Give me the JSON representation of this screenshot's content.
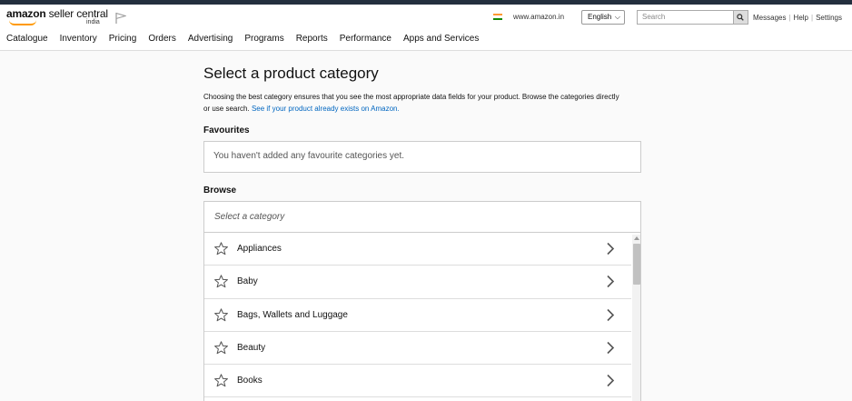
{
  "header": {
    "logo_text_bold": "amazon",
    "logo_text": " seller central",
    "logo_region": "india",
    "marketplace": "www.amazon.in",
    "language": "English",
    "search_placeholder": "Search",
    "links": [
      "Messages",
      "Help",
      "Settings"
    ]
  },
  "nav": [
    "Catalogue",
    "Inventory",
    "Pricing",
    "Orders",
    "Advertising",
    "Programs",
    "Reports",
    "Performance",
    "Apps and Services"
  ],
  "page": {
    "title": "Select a product category",
    "description": "Choosing the best category ensures that you see the most appropriate data fields for your product. Browse the categories directly or use search.",
    "description_link": "See if your product already exists on Amazon.",
    "favourites_label": "Favourites",
    "favourites_empty": "You haven't added any favourite categories yet.",
    "browse_label": "Browse",
    "category_placeholder": "Select a category"
  },
  "categories": [
    "Appliances",
    "Baby",
    "Bags, Wallets and Luggage",
    "Beauty",
    "Books"
  ],
  "colors": {
    "top_strip": "#232f3e",
    "accent": "#ff9900",
    "link": "#0066c0"
  },
  "icons": {
    "region_flag": "india-flag-icon",
    "flag": "flag-outline-icon",
    "search": "search-icon",
    "favourite": "star-outline-icon",
    "expand": "chevron-right-icon"
  }
}
